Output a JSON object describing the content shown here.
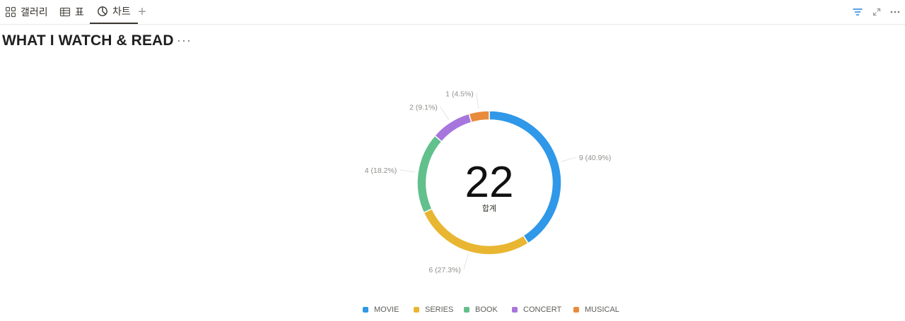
{
  "tabs": [
    {
      "label": "갤러리",
      "icon": "gallery-icon"
    },
    {
      "label": "표",
      "icon": "table-icon"
    },
    {
      "label": "차트",
      "icon": "chart-icon",
      "active": true
    }
  ],
  "add_tab_label": "+",
  "toolbar": {
    "icons": [
      "filter-icon",
      "expand-icon",
      "more-icon"
    ],
    "accent": "#2383e2"
  },
  "page": {
    "title": "WHAT I WATCH & READ",
    "more_label": "···"
  },
  "chart_data": {
    "type": "pie",
    "donut": true,
    "total": "22",
    "total_label": "합계",
    "categories": [
      "MOVIE",
      "SERIES",
      "BOOK",
      "CONCERT",
      "MUSICAL"
    ],
    "values": [
      9,
      6,
      4,
      2,
      1
    ],
    "labels": [
      "9 (40.9%)",
      "6 (27.3%)",
      "4 (18.2%)",
      "2 (9.1%)",
      "1 (4.5%)"
    ],
    "colors": [
      "#2f98e8",
      "#e9b631",
      "#62c08c",
      "#a676dd",
      "#e98b3c"
    ],
    "legend_position": "bottom"
  }
}
